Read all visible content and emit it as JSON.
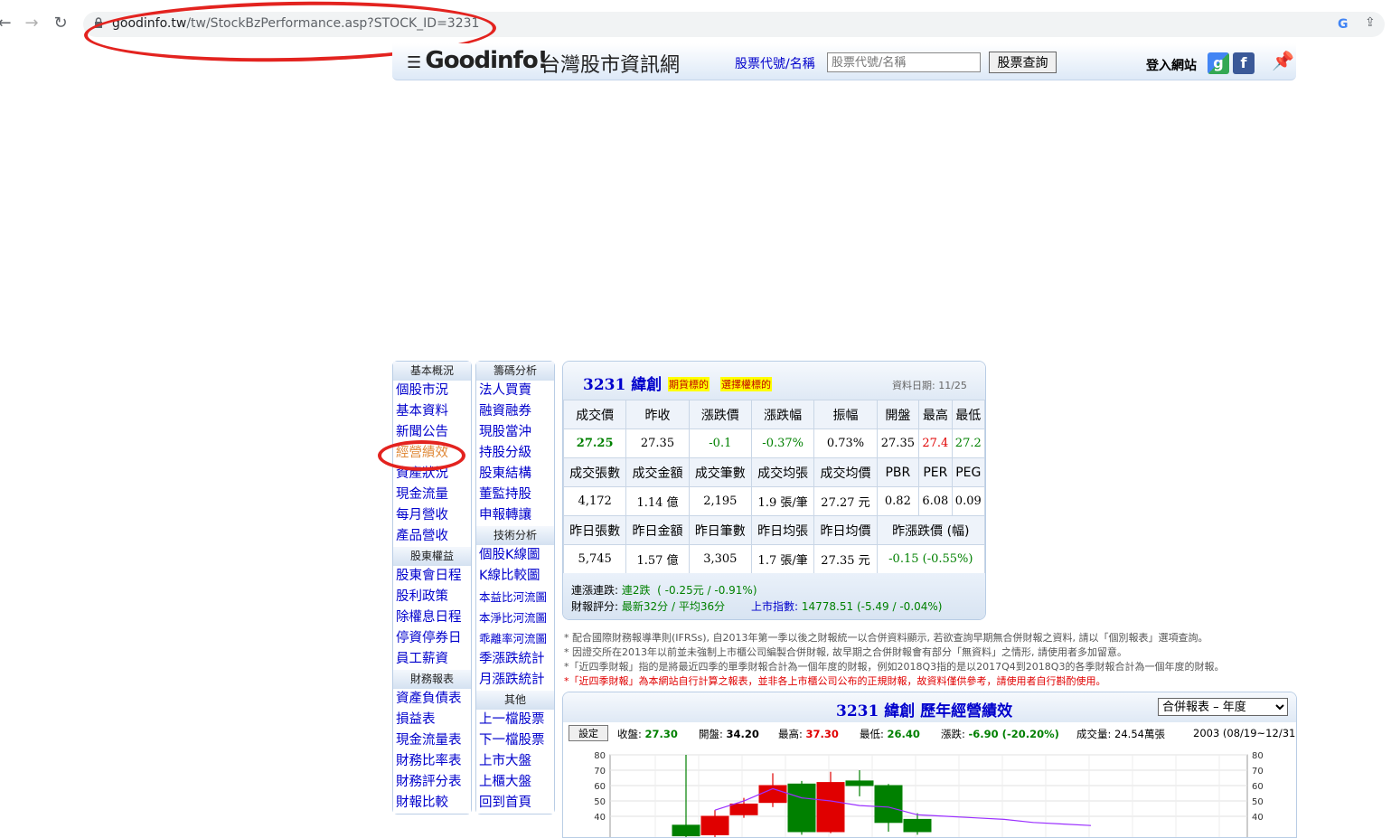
{
  "browser": {
    "url_host": "goodinfo.tw",
    "url_path": "/tw/StockBzPerformance.asp?STOCK_ID=3231"
  },
  "header": {
    "logo": "Goodinfo!",
    "site_name": "台灣股市資訊網",
    "search_label": "股票代號/名稱",
    "search_placeholder": "股票代號/名稱",
    "search_button": "股票查詢",
    "login": "登入網站"
  },
  "menu1": {
    "sections": [
      {
        "title": "基本概況",
        "items": [
          "個股市況",
          "基本資料",
          "新聞公告",
          "經營績效",
          "資產狀況",
          "現金流量",
          "每月營收",
          "產品營收"
        ]
      },
      {
        "title": "股東權益",
        "items": [
          "股東會日程",
          "股利政策",
          "除權息日程",
          "停資停券日",
          "員工薪資"
        ]
      },
      {
        "title": "財務報表",
        "items": [
          "資產負債表",
          "損益表",
          "現金流量表",
          "財務比率表",
          "財務評分表",
          "財報比較"
        ]
      }
    ]
  },
  "menu2": {
    "sections": [
      {
        "title": "籌碼分析",
        "items": [
          "法人買賣",
          "融資融券",
          "現股當沖",
          "持股分級",
          "股東結構",
          "董監持股",
          "申報轉讓"
        ]
      },
      {
        "title": "技術分析",
        "items": [
          "個股K線圖",
          "K線比較圖",
          "本益比河流圖",
          "本淨比河流圖",
          "乖離率河流圖",
          "季漲跌統計",
          "月漲跌統計"
        ]
      },
      {
        "title": "其他",
        "items": [
          "上一檔股票",
          "下一檔股票",
          "上市大盤",
          "上櫃大盤",
          "回到首頁"
        ]
      }
    ]
  },
  "quote": {
    "title": "3231 緯創",
    "tag1": "期貨標的",
    "tag2": "選擇權標的",
    "date": "資料日期: 11/25",
    "row1_head": [
      "成交價",
      "昨收",
      "漲跌價",
      "漲跌幅",
      "振幅",
      "開盤",
      "最高",
      "最低"
    ],
    "row1_vals": [
      "27.25",
      "27.35",
      "-0.1",
      "-0.37%",
      "0.73%",
      "27.35",
      "27.4",
      "27.2"
    ],
    "row2_head": [
      "成交張數",
      "成交金額",
      "成交筆數",
      "成交均張",
      "成交均價",
      "PBR",
      "PER",
      "PEG"
    ],
    "row2_vals": [
      "4,172",
      "1.14 億",
      "2,195",
      "1.9 張/筆",
      "27.27 元",
      "0.82",
      "6.08",
      "0.09"
    ],
    "row3_head": [
      "昨日張數",
      "昨日金額",
      "昨日筆數",
      "昨日均張",
      "昨日均價",
      "昨漲跌價 (幅)"
    ],
    "row3_vals": [
      "5,745",
      "1.57 億",
      "3,305",
      "1.7 張/筆",
      "27.35 元",
      "-0.15 (-0.55%)"
    ],
    "foot": {
      "streak_label": "連漲連跌:",
      "streak_val": "連2跌",
      "streak_detail": "( -0.25元 / -0.91%)",
      "score_label": "財報評分:",
      "score_val": "最新32分 / 平均36分",
      "index_label": "上市指數:",
      "index_val": "14778.51 (-5.49 / -0.04%)"
    }
  },
  "notes": [
    "* 配合國際財務報導準則(IFRSs), 自2013年第一季以後之財報統一以合併資料顯示, 若欲查詢早期無合併財報之資料, 請以「個別報表」選項查詢。",
    "* 因證交所在2013年以前並未強制上市櫃公司編製合併財報, 故早期之合併財報會有部分「無資料」之情形, 請使用者多加留意。",
    "*「近四季財報」指的是將最近四季的單季財報合計為一個年度的財報，例如2018Q3指的是以2017Q4到2018Q3的各季財報合計為一個年度的財報。",
    "*「近四季財報」為本網站自行計算之報表，並非各上市櫃公司公布的正規財報，故資料僅供參考，請使用者自行斟酌使用。"
  ],
  "chart_panel": {
    "title": "3231 緯創 歷年經營績效",
    "select_value": "合併報表 – 年度",
    "settings_button": "設定",
    "stats": [
      {
        "label": "收盤:",
        "value": "27.30",
        "color": "#008000"
      },
      {
        "label": "開盤:",
        "value": "34.20",
        "color": "#000000"
      },
      {
        "label": "最高:",
        "value": "37.30",
        "color": "#e00000"
      },
      {
        "label": "最低:",
        "value": "26.40",
        "color": "#008000"
      },
      {
        "label": "漲跌:",
        "value": "-6.90  (-20.20%)",
        "color": "#008000"
      },
      {
        "label": "成交量:",
        "value": "24.54萬張",
        "color": "#000000"
      },
      {
        "label": "",
        "value": "2003 (08/19~12/31)",
        "color": "#000000"
      }
    ]
  },
  "chart_data": {
    "type": "candlestick",
    "y_ticks": [
      80,
      70,
      60,
      50,
      40
    ],
    "ylim": [
      30,
      80
    ],
    "candles": [
      {
        "open": 34.2,
        "close": 27.3,
        "high": 80,
        "low": 26.4,
        "color": "green"
      },
      {
        "open": 28,
        "close": 40,
        "high": 44,
        "low": 26,
        "color": "red"
      },
      {
        "open": 41,
        "close": 48,
        "high": 52,
        "low": 39,
        "color": "red"
      },
      {
        "open": 49,
        "close": 60,
        "high": 68,
        "low": 46,
        "color": "red"
      },
      {
        "open": 61,
        "close": 30,
        "high": 63,
        "low": 28,
        "color": "green"
      },
      {
        "open": 30,
        "close": 62,
        "high": 69,
        "low": 29,
        "color": "red"
      },
      {
        "open": 63,
        "close": 60,
        "high": 70,
        "low": 53,
        "color": "green"
      },
      {
        "open": 60,
        "close": 36,
        "high": 61,
        "low": 30,
        "color": "green"
      },
      {
        "open": 38,
        "close": 30,
        "high": 42,
        "low": 28,
        "color": "green"
      }
    ],
    "line": [
      null,
      44,
      50,
      58,
      52,
      50,
      47,
      46,
      41,
      40,
      39,
      38,
      36,
      35,
      34
    ]
  },
  "colors": {
    "link": "#0000cc",
    "up": "#e00000",
    "down": "#008000",
    "annotation": "#e3231f"
  }
}
